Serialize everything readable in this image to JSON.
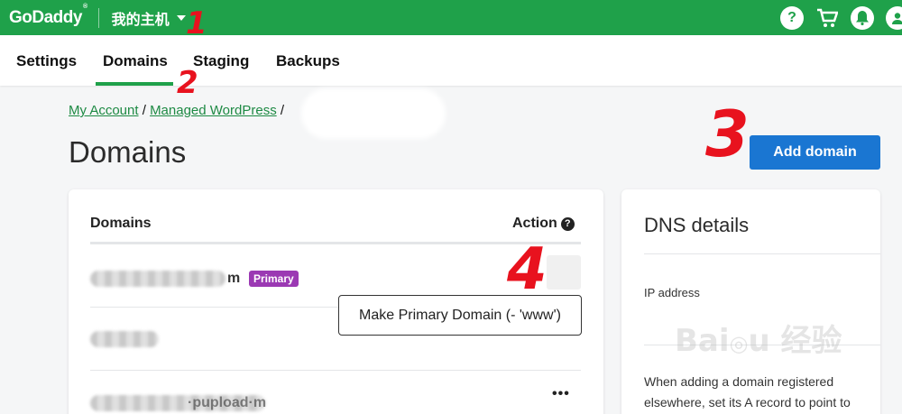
{
  "brand": {
    "logo": "GoDaddy",
    "color": "#1fa14a"
  },
  "topbar": {
    "site_name": "我的主机",
    "icons": [
      "help-icon",
      "cart-icon",
      "bell-icon",
      "avatar-icon"
    ]
  },
  "nav": {
    "tabs": [
      {
        "label": "Settings"
      },
      {
        "label": "Domains",
        "active": true
      },
      {
        "label": "Staging"
      },
      {
        "label": "Backups"
      }
    ]
  },
  "breadcrumb": {
    "items": [
      "My Account",
      "Managed WordPress"
    ],
    "separator": "/"
  },
  "page": {
    "title": "Domains",
    "add_button": "Add domain"
  },
  "domains_table": {
    "headers": {
      "domain": "Domains",
      "action": "Action"
    },
    "rows": [
      {
        "suffix": "m",
        "badge": "Primary"
      },
      {
        "suffix": ""
      },
      {
        "suffix": "·pupload·m"
      }
    ],
    "action_menu": "•••",
    "tooltip": "Make Primary Domain (- 'www')"
  },
  "dns": {
    "title": "DNS details",
    "ip_label": "IP address",
    "note": "When adding a domain registered elsewhere, set its A record to point to"
  },
  "annotations": {
    "n1": "1",
    "n2": "2",
    "n3": "3",
    "n4": "4"
  }
}
